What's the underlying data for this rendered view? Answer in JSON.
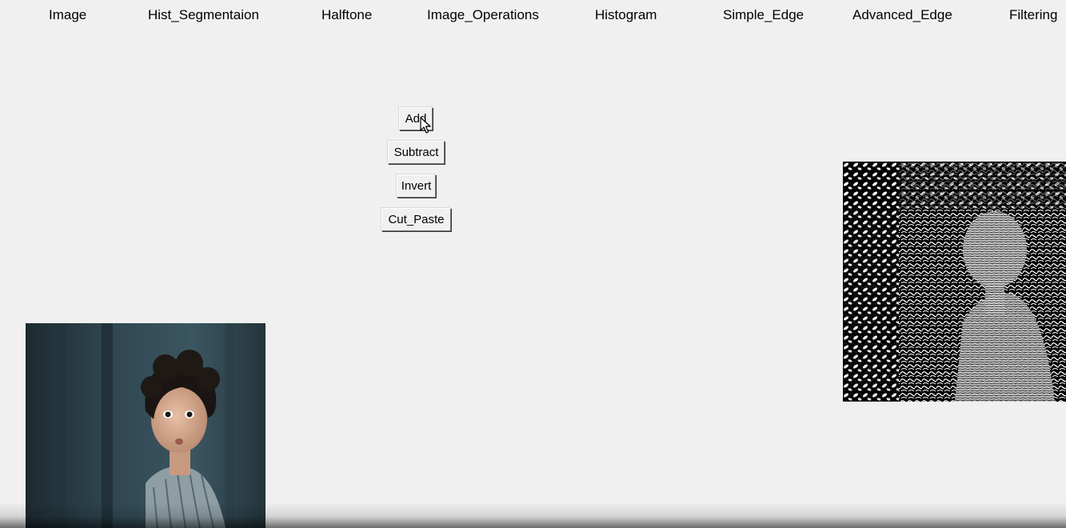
{
  "menu": {
    "items": [
      {
        "label": "Image"
      },
      {
        "label": "Hist_Segmentaion"
      },
      {
        "label": "Halftone"
      },
      {
        "label": "Image_Operations"
      },
      {
        "label": "Histogram"
      },
      {
        "label": "Simple_Edge"
      },
      {
        "label": "Advanced_Edge"
      },
      {
        "label": "Filtering"
      }
    ]
  },
  "operations": {
    "add_label": "Add",
    "subtract_label": "Subtract",
    "invert_label": "Invert",
    "cut_paste_label": "Cut_Paste"
  },
  "images": {
    "original_icon": "child-photo",
    "result_icon": "edge-detected-photo"
  },
  "colors": {
    "background": "#f0f0f0",
    "photo_bg": "#2b3d45",
    "edge_bg": "#000000"
  }
}
